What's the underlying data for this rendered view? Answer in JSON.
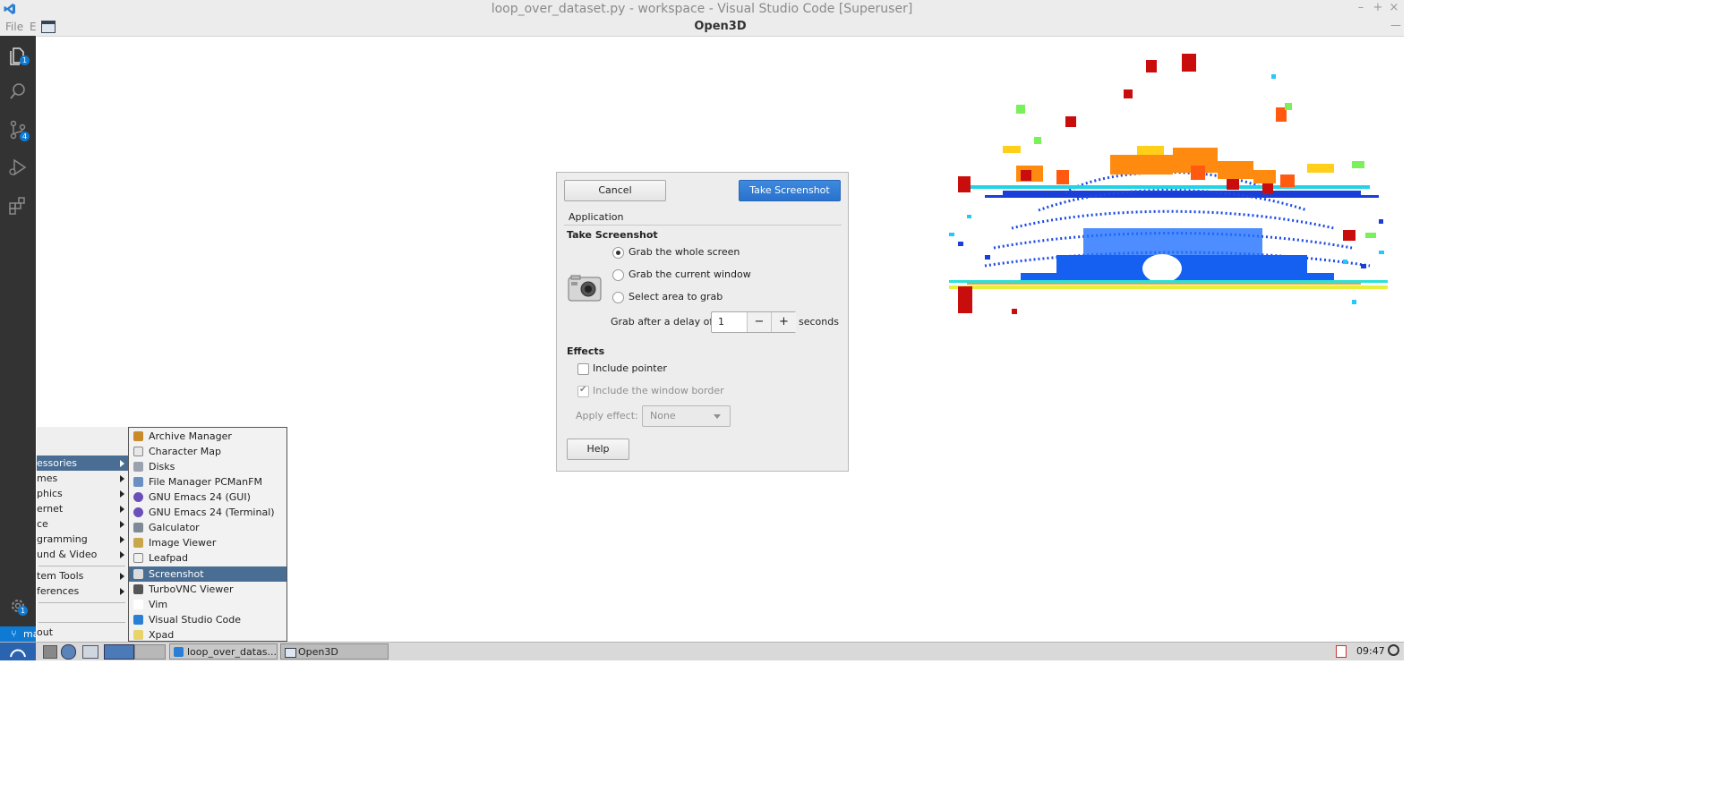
{
  "vscode": {
    "window_title": "loop_over_dataset.py - workspace - Visual Studio Code [Superuser]",
    "menu_file": "File",
    "menu_edit_partial": "E",
    "win_minimize": "–",
    "win_maximize": "+",
    "win_close": "×",
    "activity": {
      "explorer_badge": "1",
      "scm_badge": "4",
      "settings_badge": "1"
    },
    "status_branch": "ma"
  },
  "open3d": {
    "window_title": "Open3D",
    "close_glyph": "—"
  },
  "screenshot_dialog": {
    "cancel_label": "Cancel",
    "take_label": "Take Screenshot",
    "app_label": "Application",
    "section_take": "Take Screenshot",
    "radio_whole": "Grab the whole screen",
    "radio_window": "Grab the current window",
    "radio_area": "Select area to grab",
    "delay_label": "Grab after a delay of",
    "delay_value": "1",
    "delay_minus": "−",
    "delay_plus": "+",
    "delay_unit": "seconds",
    "section_effects": "Effects",
    "include_pointer": "Include pointer",
    "include_border": "Include the window border",
    "apply_effect_label": "Apply effect:",
    "apply_effect_value": "None",
    "help_label": "Help"
  },
  "main_menu": {
    "items": [
      {
        "label": "essories"
      },
      {
        "label": "mes"
      },
      {
        "label": "phics"
      },
      {
        "label": "ernet"
      },
      {
        "label": "ce"
      },
      {
        "label": "gramming"
      },
      {
        "label": "und & Video"
      },
      {
        "label": "tem Tools"
      },
      {
        "label": "ferences"
      },
      {
        "label": "out"
      }
    ]
  },
  "sub_menu": {
    "items": [
      {
        "label": "Archive Manager"
      },
      {
        "label": "Character Map"
      },
      {
        "label": "Disks"
      },
      {
        "label": "File Manager PCManFM"
      },
      {
        "label": "GNU Emacs 24 (GUI)"
      },
      {
        "label": "GNU Emacs 24 (Terminal)"
      },
      {
        "label": "Galculator"
      },
      {
        "label": "Image Viewer"
      },
      {
        "label": "Leafpad"
      },
      {
        "label": "Screenshot"
      },
      {
        "label": "TurboVNC Viewer"
      },
      {
        "label": "Vim"
      },
      {
        "label": "Visual Studio Code"
      },
      {
        "label": "Xpad"
      }
    ]
  },
  "taskbar": {
    "task_vscode": "loop_over_datas...",
    "task_open3d": "Open3D",
    "clock": "09:47"
  }
}
